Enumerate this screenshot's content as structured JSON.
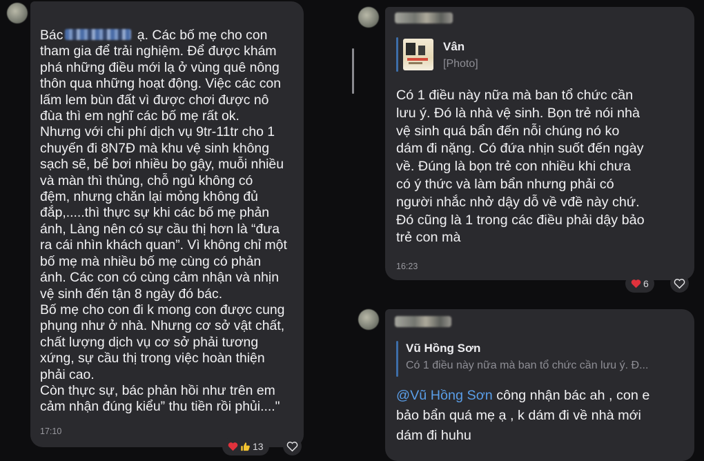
{
  "message_left": {
    "greeting_start": "Bác",
    "greeting_end": " ạ. Các bố mẹ cho con",
    "body": "tham gia để trải nghiệm. Để được khám\nphá những điều mới lạ ở vùng quê nông\nthôn qua những hoạt động. Việc các con\nlấm lem bùn đất vì được chơi được nô\nđùa thì em nghĩ các bố mẹ rất ok.\nNhưng với chi phí dịch vụ 9tr-11tr cho 1\nchuyến đi 8N7Đ mà khu vệ sinh không\nsạch sẽ, bể bơi nhiều bọ gậy, muỗi nhiều\nvà màn thì thủng, chỗ ngủ không có\nđệm, nhưng chăn lại mỏng không đủ\nđắp,.....thì thực sự khi các bố mẹ phản\nánh, Làng nên có sự cầu thị hơn là “đưa\nra cái nhìn khách quan”. Vì không chỉ một\nbố mẹ mà nhiều bố mẹ cùng có phản\nánh. Các con có cùng cảm nhận và nhịn\nvệ sinh đến tận 8 ngày đó bác.\nBố mẹ cho con đi k mong con được cung\nphụng như ở nhà. Nhưng cơ sở vật chất,\nchất lượng dịch vụ cơ sở phải tương\nxứng, sự cầu thị trong việc hoàn thiện\nphải cao.\nCòn thực sự, bác phản hồi như trên em\ncảm nhận đúng kiểu” thu tiền rồi phủi....\"",
    "time": "17:10",
    "reactions": "13"
  },
  "message_right_top": {
    "reply_name": "Vân",
    "reply_preview": "[Photo]",
    "body": "Có 1 điều này nữa mà ban tổ chức cần\nlưu ý. Đó là nhà vệ sinh. Bọn trẻ nói nhà\nvệ sinh quá bẩn đến nỗi chúng nó ko\ndám đi nặng. Có đứa nhịn suốt đến ngày\nvề. Đúng là bọn trẻ con nhiều khi chưa\ncó ý thức và làm bẩn nhưng phải có\nngười nhắc nhở dậy dỗ về vđề này chứ.\nĐó cũng là 1 trong các điều phải dậy bảo\ntrẻ con mà",
    "time": "16:23",
    "reactions": "6"
  },
  "message_right_bottom": {
    "reply_name": "Vũ Hồng Sơn",
    "reply_preview": "Có 1 điều này nữa mà ban tổ chức cần lưu ý. Đ...",
    "mention": "@Vũ Hồng Sơn",
    "body_first": " công nhận bác ah , con e",
    "body_rest": "bảo bẩn quá mẹ ạ , k dám đi về nhà mới\ndám đi huhu"
  },
  "colors": {
    "bubble": "#2a2a2e",
    "background": "#0d0d0f",
    "accent": "#3d6ea8",
    "mention": "#5a9ee8",
    "heart": "#e0323c"
  },
  "icons": [
    "heart-icon",
    "thumbs-up-icon",
    "heart-outline-icon",
    "photo-thumbnail"
  ]
}
